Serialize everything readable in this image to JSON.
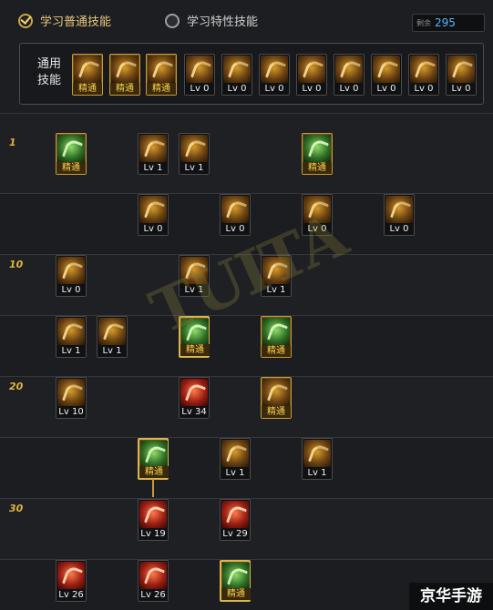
{
  "tabs": [
    {
      "label": "学习普通技能",
      "selected": true
    },
    {
      "label": "学习特性技能",
      "selected": false
    }
  ],
  "sp": {
    "label": "剩余",
    "value": "295"
  },
  "common": {
    "label": "通用\n技能",
    "skills": [
      {
        "text": "精通",
        "kind": "gold"
      },
      {
        "text": "精通",
        "kind": "gold"
      },
      {
        "text": "精通",
        "kind": "gold"
      },
      {
        "text": "Lv 0",
        "kind": "normal"
      },
      {
        "text": "Lv 0",
        "kind": "normal"
      },
      {
        "text": "Lv 0",
        "kind": "normal"
      },
      {
        "text": "Lv 0",
        "kind": "normal"
      },
      {
        "text": "Lv 0",
        "kind": "normal"
      },
      {
        "text": "Lv 0",
        "kind": "normal"
      },
      {
        "text": "Lv 0",
        "kind": "normal"
      },
      {
        "text": "Lv 0",
        "kind": "normal"
      }
    ]
  },
  "level_labels": [
    "1",
    "10",
    "20",
    "30"
  ],
  "tree": [
    {
      "text": "精通",
      "kind": "gold",
      "color": "green"
    },
    {
      "text": "Lv 1",
      "kind": "normal",
      "color": "orange"
    },
    {
      "text": "Lv 1",
      "kind": "normal",
      "color": "orange"
    },
    {
      "text": "精通",
      "kind": "gold",
      "color": "green"
    },
    {
      "text": "Lv 0",
      "kind": "normal",
      "color": "orange"
    },
    {
      "text": "Lv 0",
      "kind": "normal",
      "color": "orange"
    },
    {
      "text": "Lv 0",
      "kind": "normal",
      "color": "orange"
    },
    {
      "text": "Lv 0",
      "kind": "normal",
      "color": "orange"
    },
    {
      "text": "Lv 0",
      "kind": "normal",
      "color": "orange"
    },
    {
      "text": "Lv 1",
      "kind": "normal",
      "color": "orange"
    },
    {
      "text": "Lv 1",
      "kind": "normal",
      "color": "orange"
    },
    {
      "text": "Lv 1",
      "kind": "normal",
      "color": "orange"
    },
    {
      "text": "Lv 1",
      "kind": "normal",
      "color": "orange"
    },
    {
      "text": "精通",
      "kind": "gold",
      "color": "green",
      "highlight": true
    },
    {
      "text": "精通",
      "kind": "gold",
      "color": "green"
    },
    {
      "text": "Lv 10",
      "kind": "normal",
      "color": "orange"
    },
    {
      "text": "Lv 34",
      "kind": "normal",
      "color": "red"
    },
    {
      "text": "精通",
      "kind": "gold",
      "color": "orange"
    },
    {
      "text": "精通",
      "kind": "gold",
      "color": "green",
      "highlight": true
    },
    {
      "text": "Lv 1",
      "kind": "normal",
      "color": "orange"
    },
    {
      "text": "Lv 1",
      "kind": "normal",
      "color": "orange"
    },
    {
      "text": "Lv 19",
      "kind": "normal",
      "color": "red"
    },
    {
      "text": "Lv 29",
      "kind": "normal",
      "color": "red"
    },
    {
      "text": "Lv 26",
      "kind": "normal",
      "color": "red"
    },
    {
      "text": "Lv 26",
      "kind": "normal",
      "color": "red"
    },
    {
      "text": "精通",
      "kind": "gold",
      "color": "green",
      "highlight": true
    }
  ],
  "watermark": "TUITA",
  "corner_logo": "京华手游"
}
